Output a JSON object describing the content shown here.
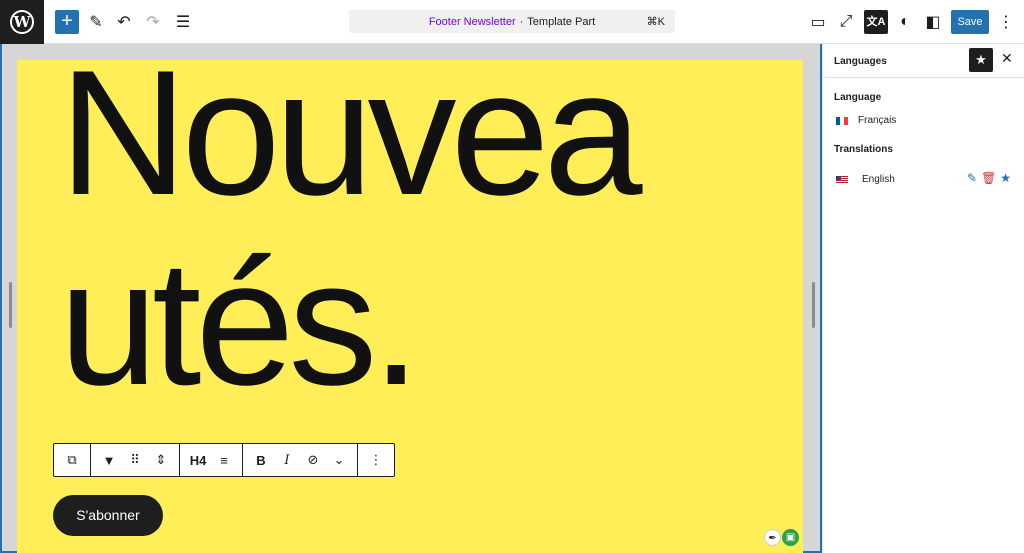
{
  "topbar": {
    "add_icon": "plus-icon",
    "tools": [
      "pencil-icon",
      "undo-icon",
      "redo-icon",
      "list-view-icon"
    ],
    "command": {
      "title": "Footer Newsletter",
      "separator": "·",
      "subtitle": "Template Part",
      "shortcut": "⌘K"
    },
    "right_icons": [
      "desktop-view-icon",
      "fullscreen-icon",
      "translate-icon",
      "styles-icon",
      "settings-panel-icon"
    ],
    "save_label": "Save",
    "more_icon": "vertical-dots-icon"
  },
  "canvas": {
    "heading_line1": "Nouvea",
    "heading_line2": "utés.",
    "subscribe_label": "S'abonner",
    "background": "#ffee58"
  },
  "block_toolbar": {
    "heading_level": "H4",
    "items": [
      "duplicate-icon",
      "bookmark-icon",
      "drag-handle-icon",
      "move-updown-icon",
      "H4",
      "align-icon",
      "bold-icon",
      "italic-icon",
      "link-icon",
      "chevron-down-icon",
      "more-icon"
    ]
  },
  "sidebar": {
    "title": "Languages",
    "language_section": "Language",
    "language_value": "Français",
    "translations_section": "Translations",
    "translations": [
      {
        "name": "English"
      }
    ]
  },
  "colors": {
    "accent": "#2271b1",
    "delete": "#d63638",
    "dark": "#1e1e1e"
  }
}
